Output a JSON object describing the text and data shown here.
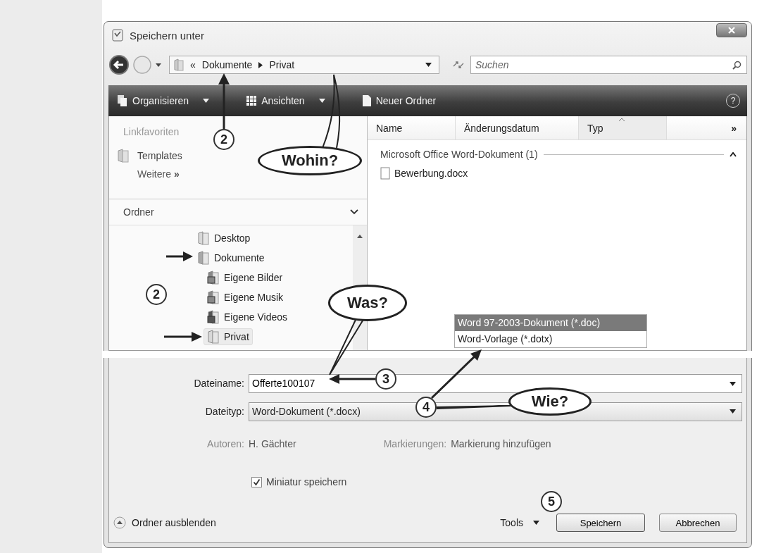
{
  "window": {
    "title": "Speichern unter"
  },
  "address": {
    "overflow": "«",
    "path": [
      "Dokumente",
      "Privat"
    ]
  },
  "search": {
    "placeholder": "Suchen"
  },
  "toolbar": [
    {
      "label": "Organisieren",
      "dropdown": true
    },
    {
      "label": "Ansichten",
      "dropdown": true
    },
    {
      "label": "Neuer Ordner",
      "dropdown": false
    }
  ],
  "help": "?",
  "favorites": {
    "title": "Linkfavoriten",
    "items": [
      {
        "label": "Templates"
      }
    ],
    "more": "Weitere",
    "more_icon": "»"
  },
  "folders": {
    "title": "Ordner",
    "tree": [
      {
        "label": "Desktop",
        "kind": "folder",
        "selected": false
      },
      {
        "label": "Dokumente",
        "kind": "documents",
        "selected": false,
        "children": [
          {
            "label": "Eigene Bilder",
            "kind": "pictures",
            "selected": false
          },
          {
            "label": "Eigene Musik",
            "kind": "music",
            "selected": false
          },
          {
            "label": "Eigene Videos",
            "kind": "videos",
            "selected": false
          },
          {
            "label": "Privat",
            "kind": "folder",
            "selected": true
          }
        ]
      }
    ]
  },
  "columns": [
    {
      "label": "Name",
      "sorted": false
    },
    {
      "label": "Änderungsdatum",
      "sorted": false
    },
    {
      "label": "Typ",
      "sorted": true
    }
  ],
  "more_columns": "»",
  "groups": [
    {
      "label": "Microsoft Office Word-Dokument (1)",
      "expanded": true,
      "files": [
        "Bewerbung.docx"
      ]
    }
  ],
  "type_dropdown": {
    "options": [
      {
        "label": "Word 97-2003-Dokument (*.doc)",
        "selected": true
      },
      {
        "label": "Word-Vorlage (*.dotx)",
        "selected": false
      }
    ]
  },
  "form": {
    "filename_label": "Dateiname:",
    "filename": "Offerte100107",
    "filetype_label": "Dateityp:",
    "filetype": "Word-Dokument (*.docx)",
    "authors_label": "Autoren:",
    "authors": "H. Gächter",
    "tags_label": "Markierungen:",
    "tags": "Markierung hinzufügen"
  },
  "thumbnail": {
    "label": "Miniatur speichern",
    "checked": true
  },
  "footer": {
    "hide_folders": "Ordner ausblenden",
    "tools": "Tools",
    "buttons": [
      "Speichern",
      "Abbrechen"
    ]
  },
  "annotations": {
    "bubbles": [
      "Wohin?",
      "Was?",
      "Wie?"
    ],
    "steps": [
      "2",
      "2",
      "3",
      "4",
      "5"
    ]
  }
}
